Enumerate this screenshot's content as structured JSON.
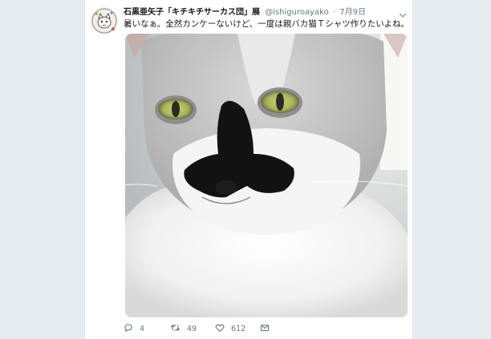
{
  "tweet": {
    "author_name": "石黒亜矢子「キチキチサーカス団」展",
    "handle": "@ishiguroayako",
    "separator": "·",
    "date": "7月9日",
    "text": "暑いなぁ。全然カンケーないけど、一度は親バカ猫Ｔシャツ作りたいよね。"
  },
  "actions": {
    "reply_count": "4",
    "retweet_count": "49",
    "like_count": "612"
  },
  "icons": {
    "reply": "reply-icon",
    "retweet": "retweet-icon",
    "like": "heart-icon",
    "message": "envelope-icon",
    "menu": "chevron-down-icon"
  },
  "colors": {
    "page_background": "#e6ecf0",
    "card_background": "#ffffff",
    "secondary_text": "#657786",
    "primary_text": "#14171a"
  }
}
